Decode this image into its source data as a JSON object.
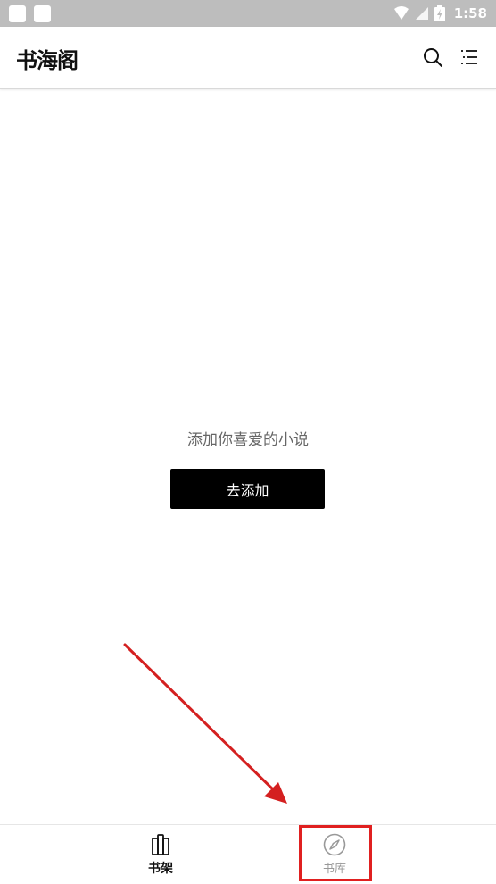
{
  "status_bar": {
    "time": "1:58"
  },
  "header": {
    "logo_text": "书海阁"
  },
  "main": {
    "empty_message": "添加你喜爱的小说",
    "add_button_label": "去添加"
  },
  "bottom_nav": {
    "items": [
      {
        "label": "书架",
        "icon": "bookshelf-icon",
        "active": true
      },
      {
        "label": "书库",
        "icon": "compass-icon",
        "active": false
      }
    ]
  },
  "annotation": {
    "arrow_color": "#d42020",
    "highlight_color": "#e02020"
  }
}
